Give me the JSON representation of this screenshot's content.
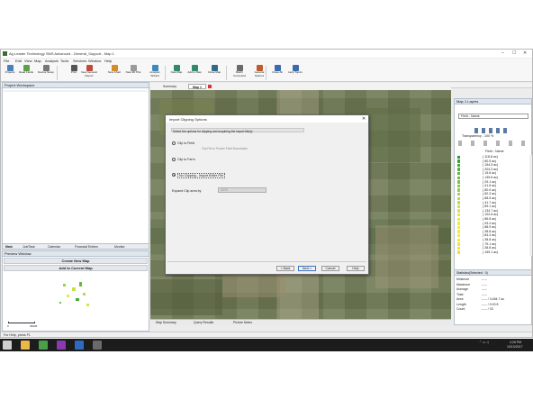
{
  "window": {
    "title": "Ag Leader Technology SMS Advanced - General_Support - Map 1",
    "min": "–",
    "max": "☐",
    "close": "✕"
  },
  "menu": [
    "File",
    "Edit",
    "View",
    "Map",
    "Analysis",
    "Tools",
    "Services",
    "Window",
    "Help"
  ],
  "ribbon": [
    {
      "label": "Projects",
      "color": "#4a7fc1"
    },
    {
      "label": "Read Fields",
      "color": "#5aa04a"
    },
    {
      "label": "Device Setup",
      "color": "#777777"
    },
    {
      "label": "Print",
      "color": "#555555"
    },
    {
      "label": "New General Report",
      "color": "#c04a3a"
    },
    {
      "label": "New Chart",
      "color": "#d68a2a"
    },
    {
      "label": "New 3D Plot",
      "color": "#9a9a9a"
    },
    {
      "label": "Analysis Wizard",
      "color": "#3a8ac0"
    },
    {
      "label": "New Map",
      "color": "#2e8a6e"
    },
    {
      "label": "Add to Map",
      "color": "#2e8a6e"
    },
    {
      "label": "Close Map",
      "color": "#2e6a8a"
    },
    {
      "label": "Batch Command",
      "color": "#6a6a6a"
    },
    {
      "label": "General Options",
      "color": "#c05a2a"
    },
    {
      "label": "Close All",
      "color": "#3a6ab0"
    },
    {
      "label": "Help Topics",
      "color": "#3a6ab0"
    }
  ],
  "workspace": {
    "title": "Project Workspace",
    "tabs": [
      "Main",
      "Job/Task",
      "Calendar",
      "Financial Entries",
      "Monitor"
    ]
  },
  "preview": {
    "title": "Preview Window",
    "create_btn": "Create New Map",
    "add_btn": "Add to Current Map",
    "scale_start": "0",
    "scale_end": "3600ft"
  },
  "map_tabs": [
    "Summary",
    "Map 1"
  ],
  "dialog": {
    "title": "Import Clipping Options",
    "instruction": "Select the options for clipping and acquiring the import file(s):",
    "options": [
      {
        "label": "Clip to Field",
        "sub": "Clip File to Proven Field Boundaries",
        "checked": false
      },
      {
        "label": "Clip to Farm",
        "sub": "",
        "checked": false
      },
      {
        "label": "No Clipping - Import Entire File",
        "sub": "",
        "checked": true
      }
    ],
    "expand_label": "Expand Clip area by",
    "expand_value": "3378",
    "buttons": {
      "back": "< Back",
      "next": "Next >",
      "cancel": "Cancel",
      "help": "Help"
    }
  },
  "bottom_tabs": [
    "Map Summary",
    "Query Results",
    "Picture Notes"
  ],
  "status": "For Help, press F1",
  "layers": {
    "title": "Map 1 Layers",
    "dropdown": "Field - Name",
    "transparency": "Transparency - 100 %",
    "legend_title": "Field - Name",
    "items": [
      {
        "text": "( 118.8 ac)",
        "color": "#2e9a2e"
      },
      {
        "text": "( 80.5 ac)",
        "color": "#3aa233"
      },
      {
        "text": "( 154.5 ac)",
        "color": "#45aa38"
      },
      {
        "text": "( 204.3 ac)",
        "color": "#52b23c"
      },
      {
        "text": "( 15.8 ac)",
        "color": "#5fb840"
      },
      {
        "text": "( 139.6 ac)",
        "color": "#6cbe43"
      },
      {
        "text": "( 29.1 ac)",
        "color": "#79c446"
      },
      {
        "text": "( 41.8 ac)",
        "color": "#87ca48"
      },
      {
        "text": "( 80.0 ac)",
        "color": "#95cf4a"
      },
      {
        "text": "( 82.3 ac)",
        "color": "#a3d44c"
      },
      {
        "text": "( 88.5 ac)",
        "color": "#b0d94d"
      },
      {
        "text": "( 41.7 ac)",
        "color": "#bddd4e"
      },
      {
        "text": "( 89.1 ac)",
        "color": "#c9e14f"
      },
      {
        "text": "( 134.7 ac)",
        "color": "#d4e550"
      },
      {
        "text": "( 102.6 ac)",
        "color": "#dee850"
      },
      {
        "text": "( 86.8 ac)",
        "color": "#e6ea4f"
      },
      {
        "text": "( 93.4 ac)",
        "color": "#ecec4c"
      },
      {
        "text": "( 88.9 ac)",
        "color": "#f0ec48"
      },
      {
        "text": "( 38.8 ac)",
        "color": "#f2ea44"
      },
      {
        "text": "( 84.4 ac)",
        "color": "#f4e840"
      },
      {
        "text": "( 38.8 ac)",
        "color": "#f5e63c"
      },
      {
        "text": "( 79.1 ac)",
        "color": "#f6e438"
      },
      {
        "text": "( 38.8 ac)",
        "color": "#f7e234"
      },
      {
        "text": "( 159.1 ac)",
        "color": "#f8e030"
      }
    ],
    "stats_title": "Statistics(Selected : 0)",
    "stats": [
      {
        "k": "Minimum",
        "v": "-----"
      },
      {
        "k": "Maximum",
        "v": "-----"
      },
      {
        "k": "Average",
        "v": "-----"
      },
      {
        "k": "Total",
        "v": "-----"
      },
      {
        "k": "Area",
        "v": "----- / 3,464.7 ac"
      },
      {
        "k": "Length",
        "v": "----- / 0.00 ft"
      },
      {
        "k": "Count",
        "v": "----- / 33"
      }
    ]
  },
  "taskbar": {
    "time": "4:26 PM",
    "date": "10/13/2017",
    "apps": [
      {
        "name": "windows",
        "color": "#cfcfcf"
      },
      {
        "name": "explorer",
        "color": "#e8b84a"
      },
      {
        "name": "chrome",
        "color": "#4a9e4a"
      },
      {
        "name": "onenote",
        "color": "#8a3ab0"
      },
      {
        "name": "outlook",
        "color": "#2e6ac0"
      },
      {
        "name": "sms",
        "color": "#6a6a6a"
      }
    ]
  }
}
